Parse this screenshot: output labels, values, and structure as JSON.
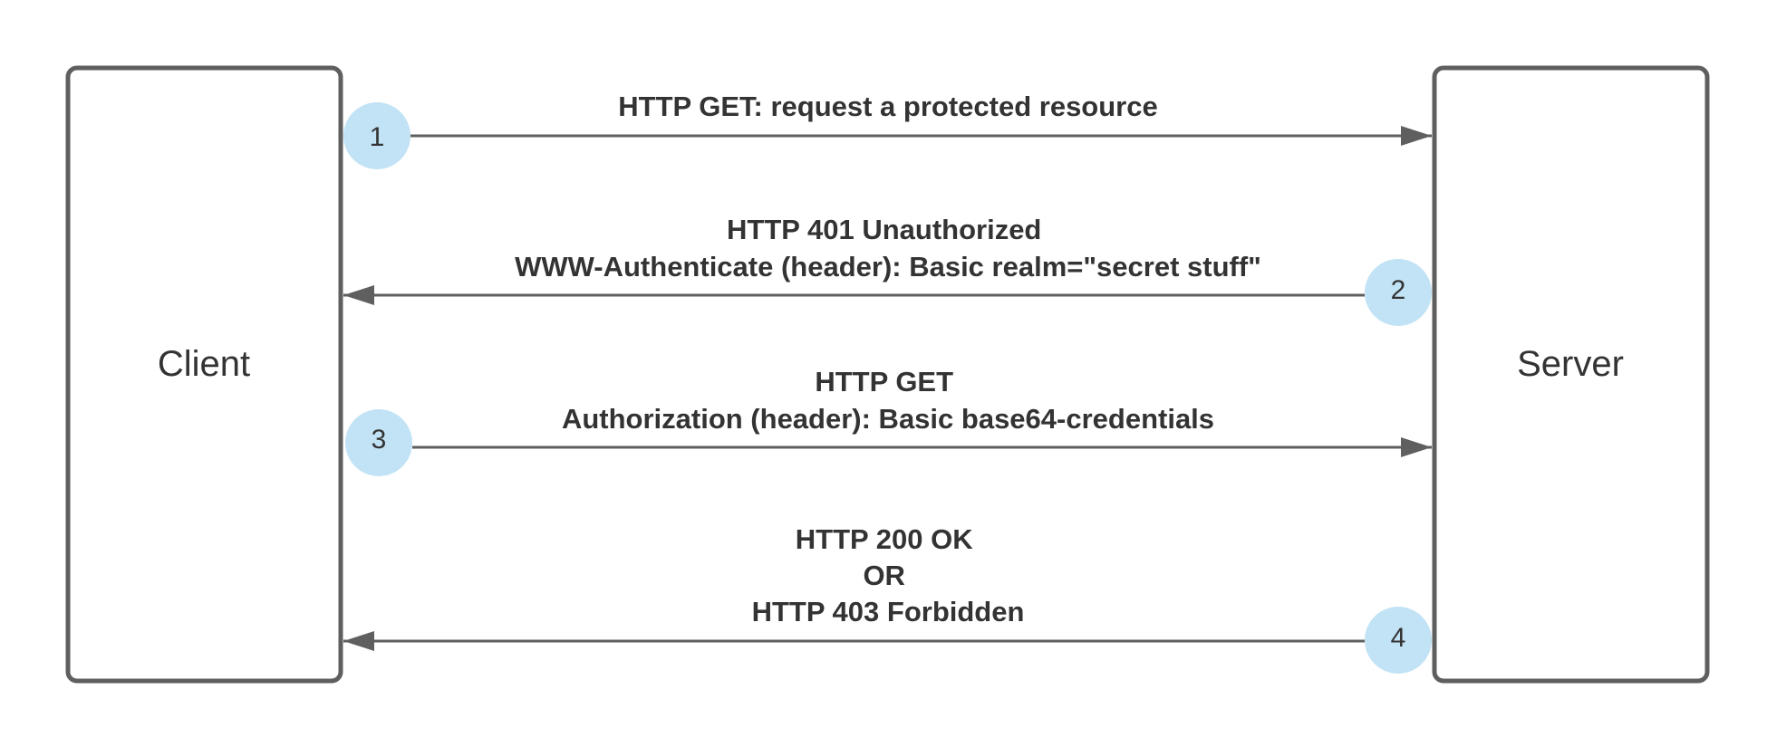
{
  "participants": {
    "client": {
      "label": "Client"
    },
    "server": {
      "label": "Server"
    }
  },
  "messages": [
    {
      "step": "1",
      "direction": "client-to-server",
      "lines": [
        "HTTP GET: request a protected resource"
      ]
    },
    {
      "step": "2",
      "direction": "server-to-client",
      "lines": [
        "HTTP 401 Unauthorized",
        "WWW-Authenticate (header): Basic realm=\"secret stuff\""
      ]
    },
    {
      "step": "3",
      "direction": "client-to-server",
      "lines": [
        "HTTP GET",
        "Authorization (header): Basic base64-credentials"
      ]
    },
    {
      "step": "4",
      "direction": "server-to-client",
      "lines": [
        "HTTP 200 OK",
        "OR",
        "HTTP 403 Forbidden"
      ]
    }
  ],
  "colors": {
    "box_stroke": "#5f5f5f",
    "arrow": "#5f5f5f",
    "step_badge": "#c2e3f5",
    "text": "#333333"
  }
}
